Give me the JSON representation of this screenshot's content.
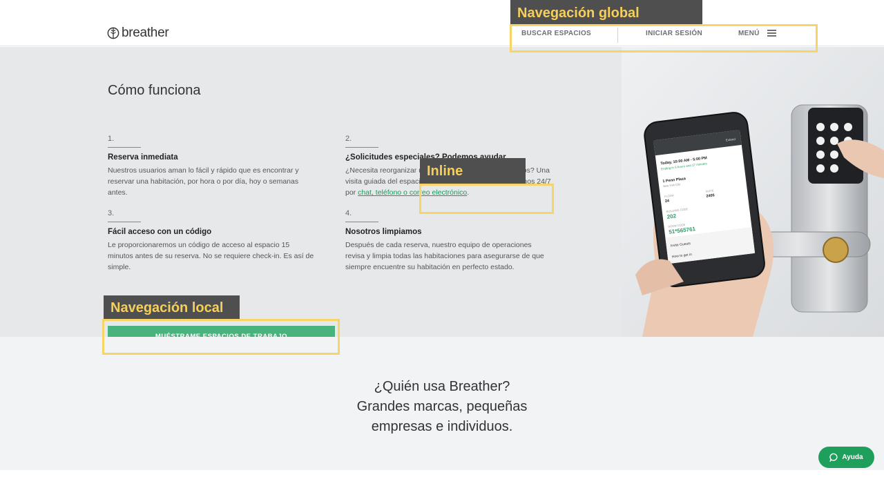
{
  "header": {
    "logo_text": "breather",
    "nav": {
      "search_label": "BUSCAR ESPACIOS",
      "login_label": "INICIAR SESIÓN",
      "menu_label": "MENÚ"
    }
  },
  "how_it_works": {
    "title": "Cómo funciona",
    "steps": [
      {
        "number": "1.",
        "title": "Reserva inmediata",
        "text": "Nuestros usuarios aman lo fácil y rápido que es encontrar y reservar una habitación, por hora o por día, hoy o semanas antes."
      },
      {
        "number": "2.",
        "title": "¿Solicitudes especiales? Podemos ayudar",
        "text_before": "¿Necesita reorganizar una habitación? ¿Invitar a terceros? Una visita guiada del espacio antes de reservar? Solo háblanos 24/7 por ",
        "link": "chat, teléfono o correo electrónico",
        "text_after": "."
      },
      {
        "number": "3.",
        "title": "Fácil acceso con un código",
        "text": "Le proporcionaremos un código de acceso al espacio 15 minutos antes de su reserva. No se requiere check-in. Es así de simple."
      },
      {
        "number": "4.",
        "title": "Nosotros limpiamos",
        "text": "Después de cada reserva, nuestro equipo de operaciones revisa y limpia todas las habitaciones para asegurarse de que siempre encuentre su habitación en perfecto estado."
      }
    ],
    "cta_label": "MUÉSTRAME ESPACIOS DE TRABAJO"
  },
  "phone_screen": {
    "time": "Today, 10:00 AM - 5:00 PM",
    "ending": "Ending in 5 hours and 17 minutes",
    "place": "1 Penn Plaza",
    "city": "New York City",
    "floor_label": "FLOOR",
    "floor_value": "24",
    "suite_label": "SUITE",
    "suite_value": "2405",
    "building_code_label": "BUILDING CODE",
    "building_code_value": "202",
    "room_code_label": "ROOM CODE",
    "room_code_value": "51*565761",
    "invite": "Invite Guests",
    "how_to": "How to get in",
    "extend": "Extend"
  },
  "who_uses": {
    "line1": "¿Quién usa Breather?",
    "line2": "Grandes marcas, pequeñas",
    "line3": "empresas e individuos."
  },
  "help_label": "Ayuda",
  "annotations": {
    "global": "Navegación global",
    "inline": "Inline",
    "local": "Navegación local"
  },
  "colors": {
    "accent_green": "#48b37c",
    "help_green": "#1ea05c",
    "annotation_yellow": "#f6d465",
    "annotation_label_bg": "#4f4f4f"
  }
}
